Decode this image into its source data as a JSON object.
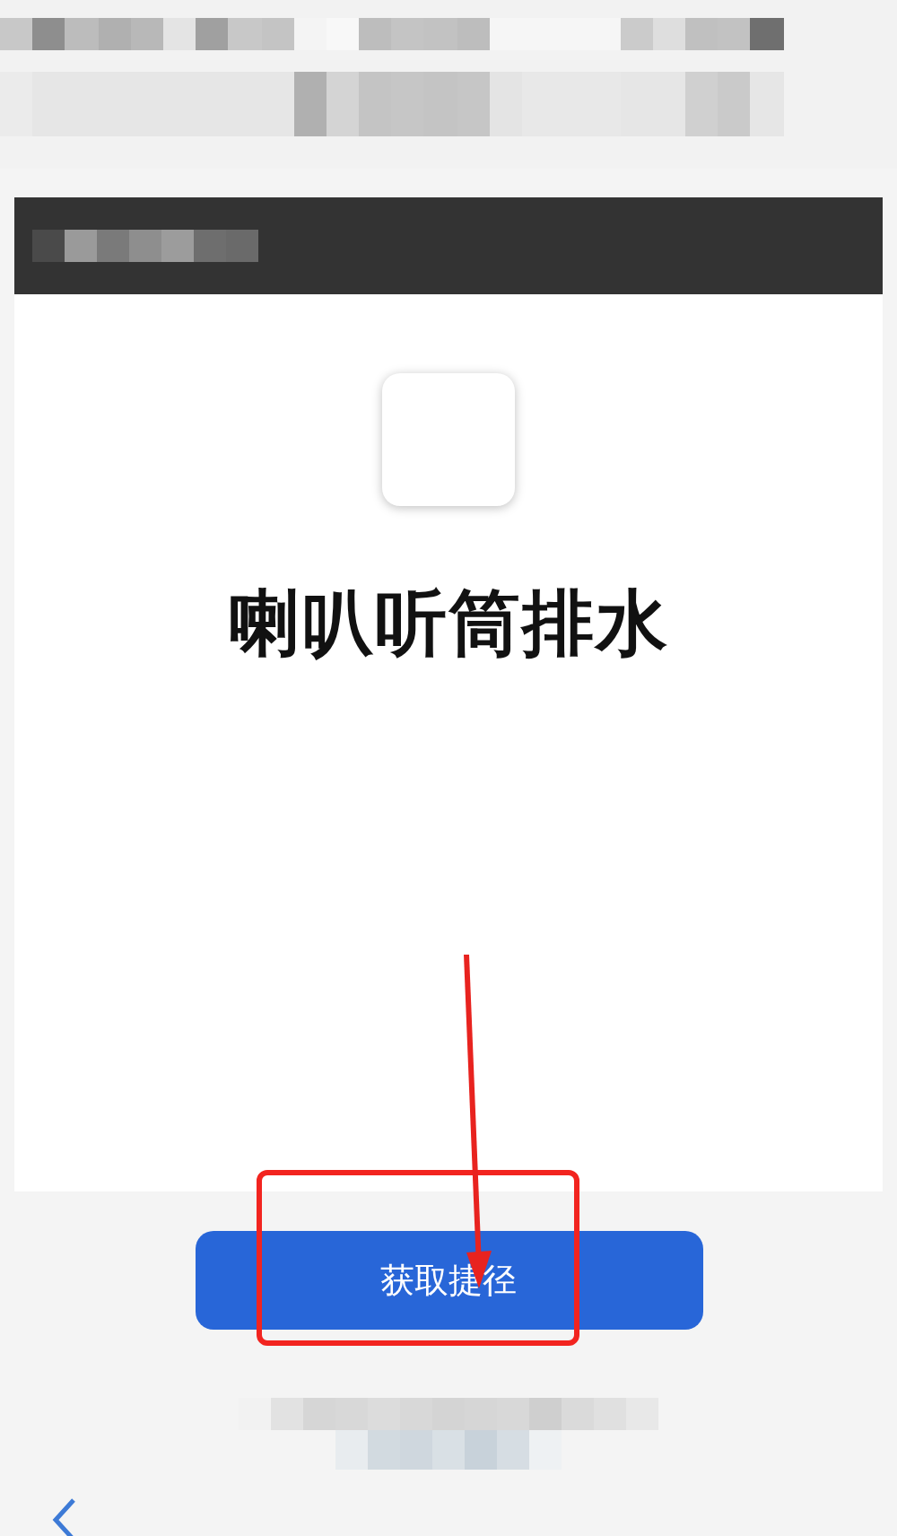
{
  "shortcut": {
    "title": "喇叭听筒排水"
  },
  "actions": [
    {
      "label": "获取捷径",
      "kind": "primary"
    }
  ]
}
